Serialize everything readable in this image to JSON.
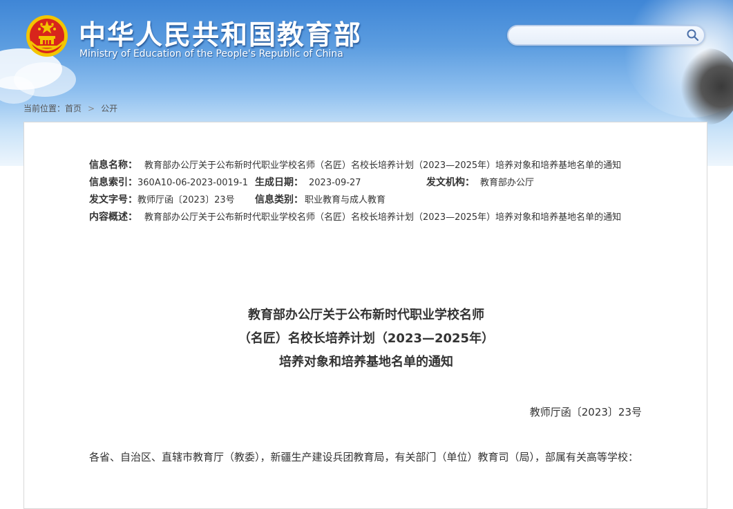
{
  "header": {
    "site_name_cn": "中华人民共和国教育部",
    "site_name_en": "Ministry of Education of the People's Republic of China",
    "emblem_icon": "national-emblem-icon",
    "search": {
      "value": "",
      "placeholder": "",
      "icon": "search-icon"
    }
  },
  "breadcrumb": {
    "prefix": "当前位置：",
    "items": [
      "首页",
      "公开"
    ],
    "separator": ">"
  },
  "meta": {
    "name_label": "信息名称：",
    "name_value": "教育部办公厅关于公布新时代职业学校名师（名匠）名校长培养计划（2023—2025年）培养对象和培养基地名单的通知",
    "index_label": "信息索引：",
    "index_value": "360A10-06-2023-0019-1",
    "date_label": "生成日期：",
    "date_value": "2023-09-27",
    "org_label": "发文机构：",
    "org_value": "教育部办公厅",
    "docno_label": "发文字号：",
    "docno_value": "教师厅函〔2023〕23号",
    "category_label": "信息类别：",
    "category_value": "职业教育与成人教育",
    "summary_label": "内容概述：",
    "summary_value": "教育部办公厅关于公布新时代职业学校名师（名匠）名校长培养计划（2023—2025年）培养对象和培养基地名单的通知"
  },
  "article": {
    "title_line1": "教育部办公厅关于公布新时代职业学校名师",
    "title_line2": "（名匠）名校长培养计划（2023—2025年）",
    "title_line3": "培养对象和培养基地名单的通知",
    "doc_number": "教师厅函〔2023〕23号",
    "salutation": "各省、自治区、直辖市教育厅（教委），新疆生产建设兵团教育局，有关部门（单位）教育司（局），部属有关高等学校："
  },
  "colors": {
    "sky_top": "#3f86d6",
    "emblem_red": "#d8251c",
    "emblem_gold": "#f3c500",
    "text": "#333333"
  }
}
